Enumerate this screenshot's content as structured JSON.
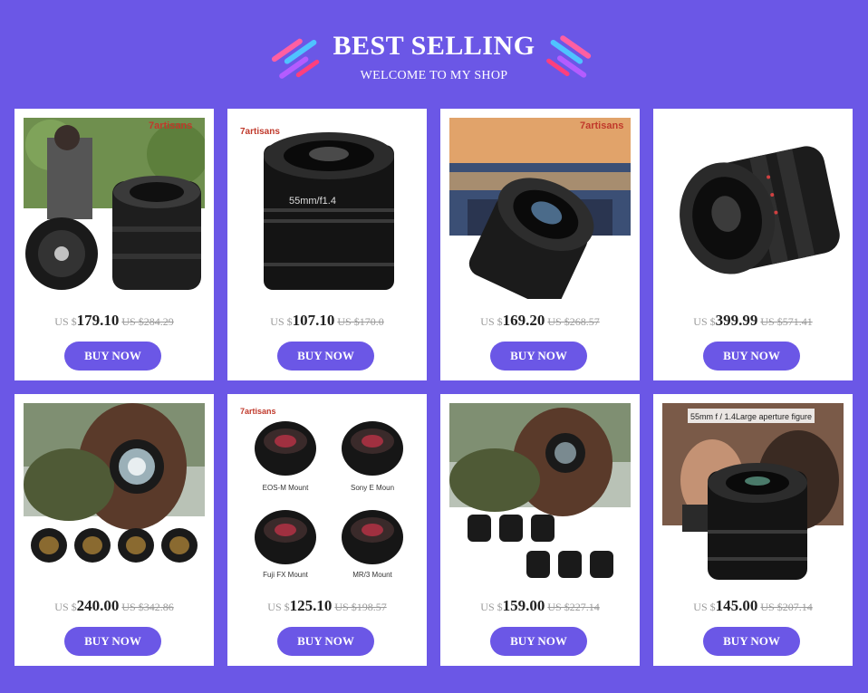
{
  "header": {
    "title": "BEST SELLING",
    "subtitle": "WELCOME TO MY SHOP"
  },
  "colors": {
    "background": "#6b57e6",
    "button": "#6b57e6",
    "card": "#ffffff"
  },
  "products": [
    {
      "currency": "US $",
      "price": "179.10",
      "old_price": "US $284.29",
      "button": "BUY NOW",
      "image_texts": {
        "brand": "7artisans"
      }
    },
    {
      "currency": "US $",
      "price": "107.10",
      "old_price": "US $170.0",
      "button": "BUY NOW",
      "image_texts": {
        "brand": "7artisans",
        "lens": "55mm/f1.4"
      }
    },
    {
      "currency": "US $",
      "price": "169.20",
      "old_price": "US $268.57",
      "button": "BUY NOW",
      "image_texts": {
        "brand": "7artisans"
      }
    },
    {
      "currency": "US $",
      "price": "399.99",
      "old_price": "US $571.41",
      "button": "BUY NOW",
      "image_texts": {}
    },
    {
      "currency": "US $",
      "price": "240.00",
      "old_price": "US $342.86",
      "button": "BUY NOW",
      "image_texts": {}
    },
    {
      "currency": "US $",
      "price": "125.10",
      "old_price": "US $198.57",
      "button": "BUY NOW",
      "image_texts": {
        "brand": "7artisans",
        "mounts": [
          "EOS-M Mount",
          "Sony E Moun",
          "Fuji FX Mount",
          "MR/3 Mount"
        ]
      }
    },
    {
      "currency": "US $",
      "price": "159.00",
      "old_price": "US $227.14",
      "button": "BUY NOW",
      "image_texts": {}
    },
    {
      "currency": "US $",
      "price": "145.00",
      "old_price": "US $207.14",
      "button": "BUY NOW",
      "image_texts": {
        "banner": "55mm f / 1.4Large aperture figure"
      }
    }
  ]
}
